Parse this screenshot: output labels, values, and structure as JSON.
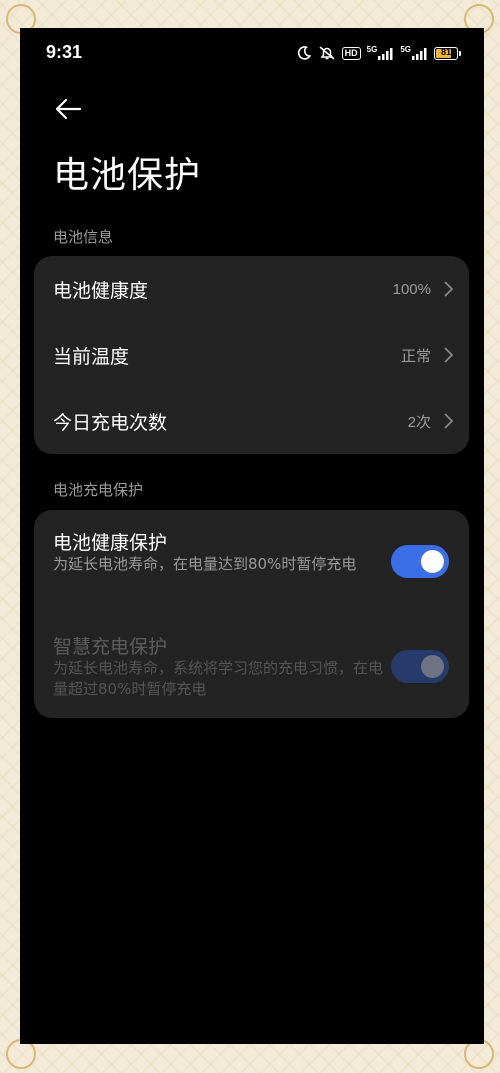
{
  "status_bar": {
    "time": "9:31",
    "hd_label": "HD",
    "network1": "5G",
    "network2": "5G",
    "battery_level": "81",
    "battery_color": "#f2b233"
  },
  "header": {
    "back_icon": "arrow-left-icon",
    "title": "电池保护"
  },
  "battery_info": {
    "section_label": "电池信息",
    "rows": [
      {
        "label": "电池健康度",
        "value": "100%"
      },
      {
        "label": "当前温度",
        "value": "正常"
      },
      {
        "label": "今日充电次数",
        "value": "2次"
      }
    ]
  },
  "charge_protection": {
    "section_label": "电池充电保护",
    "items": [
      {
        "title": "电池健康保护",
        "description": "为延长电池寿命，在电量达到80%时暂停充电",
        "enabled": true,
        "disabled": false
      },
      {
        "title": "智慧充电保护",
        "description": "为延长电池寿命，系统将学习您的充电习惯，在电量超过80%时暂停充电",
        "enabled": true,
        "disabled": true
      }
    ]
  },
  "colors": {
    "accent": "#3a6fe8",
    "accent_disabled": "#263b6b",
    "card_bg": "#232323",
    "background": "#000000"
  }
}
